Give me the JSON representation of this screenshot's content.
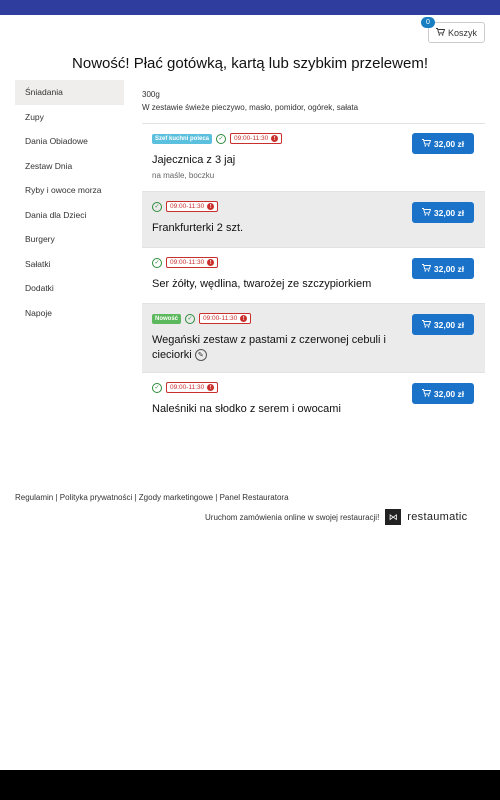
{
  "header": {
    "cart_label": "Koszyk",
    "cart_count": "0"
  },
  "headline": "Nowość! Płać gotówką, kartą lub szybkim przelewem!",
  "sidebar": {
    "items": [
      {
        "label": "Śniadania"
      },
      {
        "label": "Zupy"
      },
      {
        "label": "Dania Obiadowe"
      },
      {
        "label": "Zestaw Dnia"
      },
      {
        "label": "Ryby i owoce morza"
      },
      {
        "label": "Dania dla Dzieci"
      },
      {
        "label": "Burgery"
      },
      {
        "label": "Sałatki"
      },
      {
        "label": "Dodatki"
      },
      {
        "label": "Napoje"
      }
    ]
  },
  "category_info": {
    "weight": "300g",
    "description": "W zestawie świeże pieczywo, masło, pomidor, ogórek, sałata"
  },
  "items": [
    {
      "name": "Jajecznica z 3 jaj",
      "subtitle": "na maśle, boczku",
      "badge": "Szef kuchni poleca",
      "time": "09:00-11:30",
      "price": "32,00 zł"
    },
    {
      "name": "Frankfurterki 2 szt.",
      "time": "09:00-11:30",
      "price": "32,00 zł"
    },
    {
      "name": "Ser żółty, wędlina, twarożej ze szczypiorkiem",
      "time": "09:00-11:30",
      "price": "32,00 zł"
    },
    {
      "name": "Wegański zestaw z pastami z czerwonej cebuli i cieciorki",
      "badge": "Nowość",
      "time": "09:00-11:30",
      "price": "32,00 zł"
    },
    {
      "name": "Naleśniki na słodko z serem i owocami",
      "time": "09:00-11:30",
      "price": "32,00 zł"
    }
  ],
  "footer": {
    "links": [
      "Regulamin",
      "Polityka prywatności",
      "Zgody marketingowe",
      "Panel Restauratora"
    ],
    "promo": "Uruchom zamówienia online w swojej restauracji!",
    "brand": "restaumatic"
  },
  "icons": {
    "cart": "cart-icon",
    "check": "check-circle-icon",
    "warning": "exclamation-icon",
    "pencil": "pencil-icon"
  },
  "colors": {
    "primary": "#1a73c9",
    "topbar": "#2f3e9e",
    "time_badge": "#c9302c",
    "chef_badge": "#5bc0de",
    "new_badge": "#5cb85c"
  }
}
